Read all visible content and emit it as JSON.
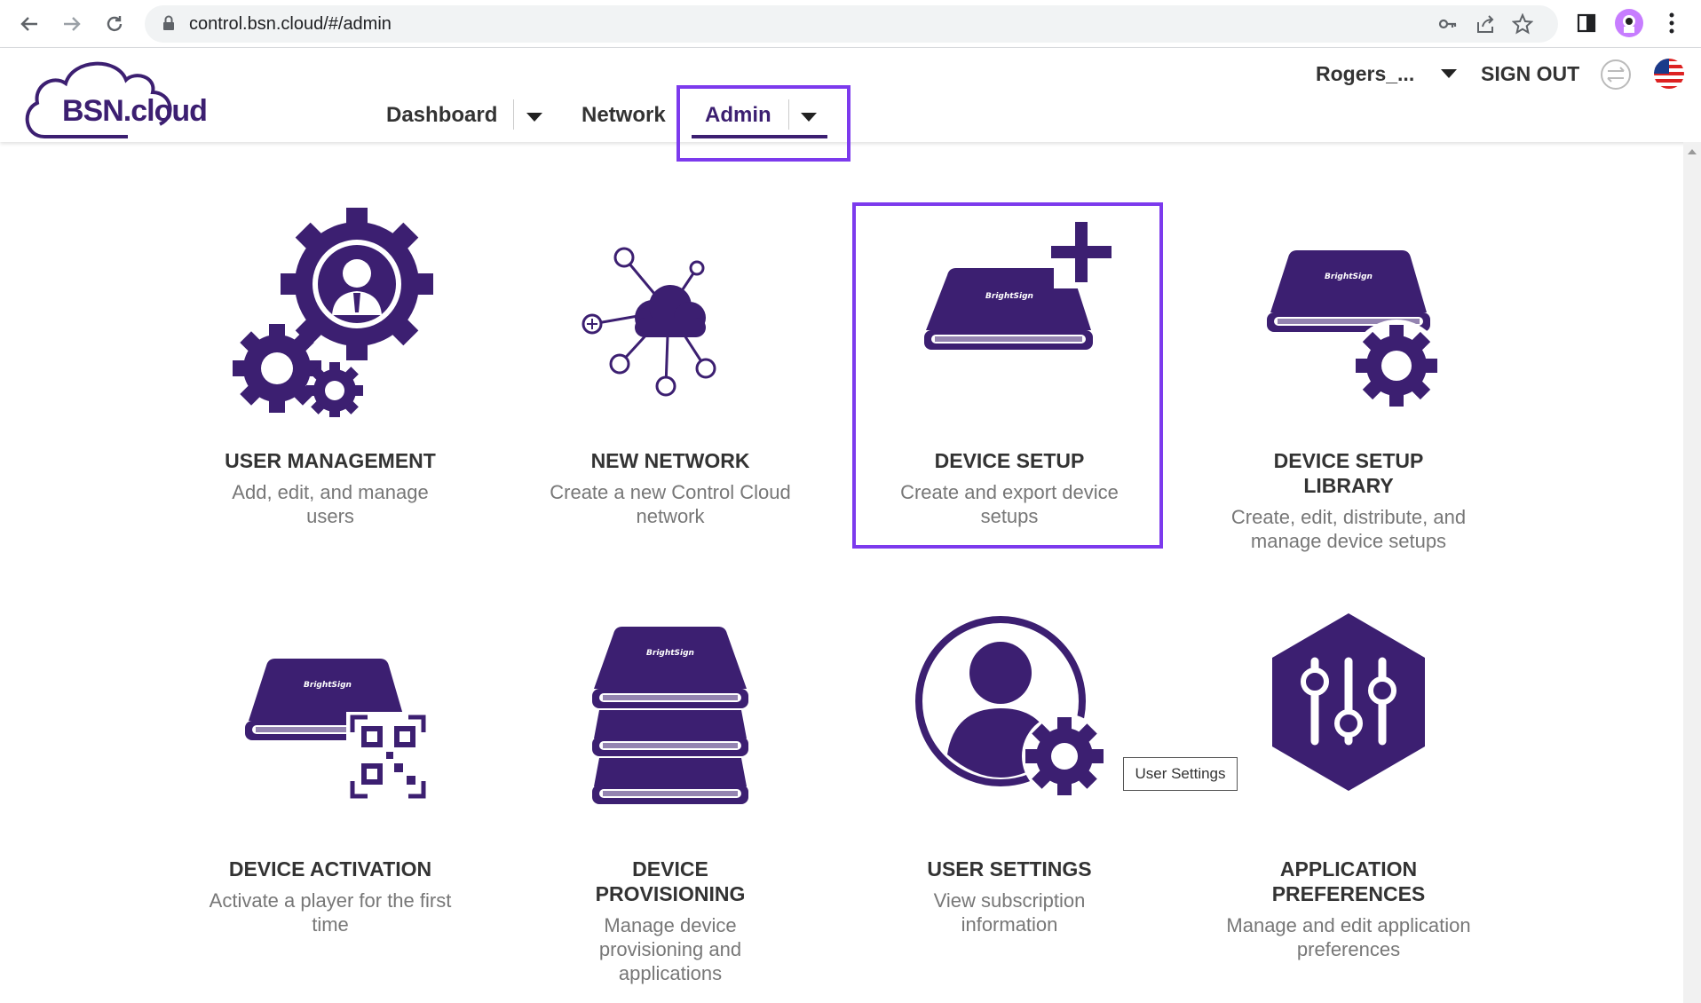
{
  "browser": {
    "url": "control.bsn.cloud/#/admin",
    "icons": [
      "back-arrow-icon",
      "forward-arrow-icon",
      "reload-icon",
      "lock-icon",
      "key-icon",
      "share-icon",
      "star-icon",
      "side-panel-icon",
      "profile-avatar-icon",
      "kebab-menu-icon"
    ]
  },
  "header": {
    "logo_text": "BSN.cloud",
    "nav": {
      "dashboard": "Dashboard",
      "network": "Network",
      "admin": "Admin"
    },
    "user_name": "Rogers_...",
    "sign_out": "SIGN OUT",
    "colors": {
      "brand_purple": "#3c1f71",
      "highlight": "#7c3aed"
    }
  },
  "tiles": [
    {
      "title": "USER MANAGEMENT",
      "desc": "Add, edit, and manage users"
    },
    {
      "title": "NEW NETWORK",
      "desc": "Create a new Control Cloud network"
    },
    {
      "title": "DEVICE SETUP",
      "desc": "Create and export device setups"
    },
    {
      "title": "DEVICE SETUP LIBRARY",
      "desc": "Create, edit, distribute, and manage device setups"
    },
    {
      "title": "DEVICE ACTIVATION",
      "desc": "Activate a player for the first time"
    },
    {
      "title": "DEVICE PROVISIONING",
      "desc": "Manage device provisioning and applications"
    },
    {
      "title": "USER SETTINGS",
      "desc": "View subscription information"
    },
    {
      "title": "APPLICATION PREFERENCES",
      "desc": "Manage and edit application preferences"
    }
  ],
  "tooltip": "User Settings",
  "device_brand": "BrightSign"
}
